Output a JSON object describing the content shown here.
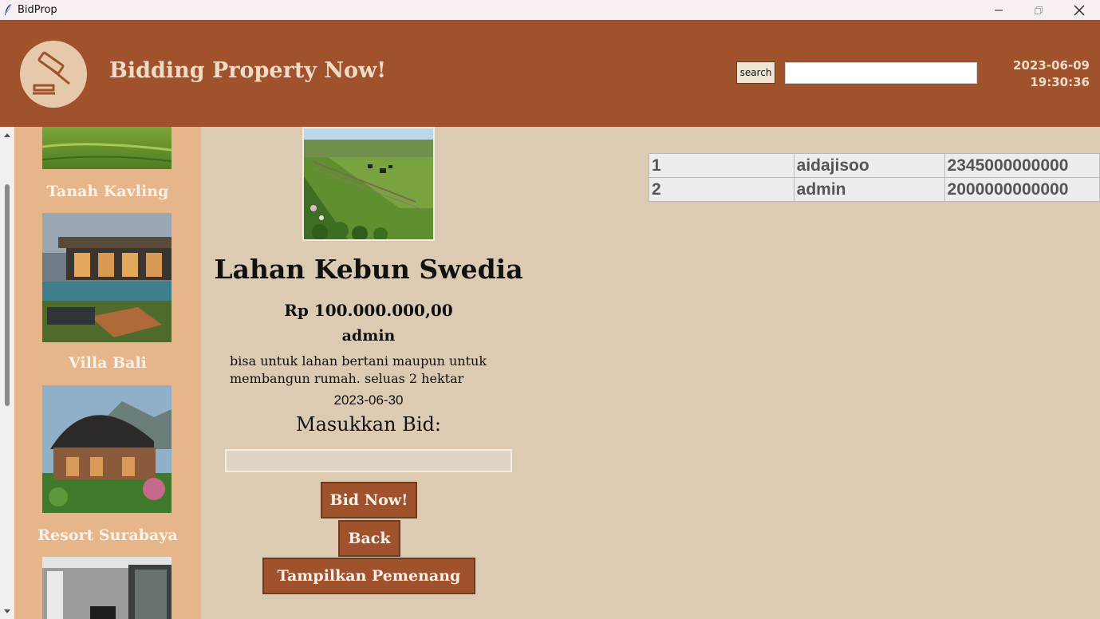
{
  "window": {
    "title": "BidProp",
    "icon": "feather-icon"
  },
  "header": {
    "logo_icon": "gavel-icon",
    "title": "Bidding Property Now!",
    "search_button": "search",
    "search_value": "",
    "date": "2023-06-09",
    "time": "19:30:36"
  },
  "sidebar": {
    "items": [
      {
        "label": "Tanah Kavling",
        "image": "green-field-photo"
      },
      {
        "label": "Villa Bali",
        "image": "modern-villa-pool-photo"
      },
      {
        "label": "Resort Surabaya",
        "image": "resort-house-mountain-photo"
      },
      {
        "label": "",
        "image": "interior-room-photo"
      }
    ]
  },
  "detail": {
    "image": "farm-field-horses-photo",
    "title": "Lahan Kebun Swedia",
    "price": "Rp 100.000.000,00",
    "owner": "admin",
    "description": "bisa untuk lahan bertani maupun untuk membangun rumah. seluas 2 hektar",
    "date": "2023-06-30",
    "bid_label": "Masukkan Bid:",
    "bid_value": "",
    "buttons": {
      "bid": "Bid Now!",
      "back": "Back",
      "winner": "Tampilkan Pemenang"
    }
  },
  "bids": {
    "rows": [
      [
        "1",
        "aidajisoo",
        "2345000000000"
      ],
      [
        "2",
        "admin",
        "2000000000000"
      ]
    ]
  },
  "colors": {
    "header": "#a0522d",
    "background": "#dccab3",
    "sidebar": "#e6b68a",
    "button": "#a0522d"
  }
}
